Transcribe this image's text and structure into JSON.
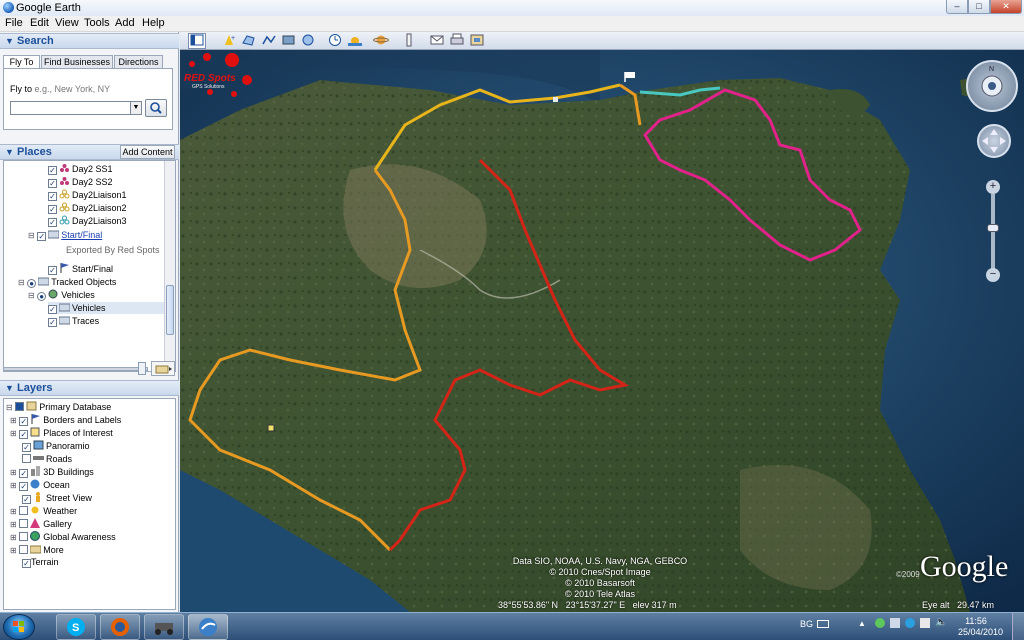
{
  "window": {
    "title": "Google Earth",
    "controls": {
      "minimize": "–",
      "maximize": "□",
      "close": "✕"
    }
  },
  "menu": [
    "File",
    "Edit",
    "View",
    "Tools",
    "Add",
    "Help"
  ],
  "search": {
    "header": "Search",
    "tabs": [
      "Fly To",
      "Find Businesses",
      "Directions"
    ],
    "fly_to_label": "Fly to",
    "fly_to_hint": "e.g., New York, NY",
    "input_value": ""
  },
  "places": {
    "header": "Places",
    "add_content_label": "Add Content",
    "items": [
      {
        "label": "Day2 SS1",
        "checked": true,
        "link": false
      },
      {
        "label": "Day2 SS2",
        "checked": true,
        "link": false
      },
      {
        "label": "Day2Liaison1",
        "checked": true,
        "link": false
      },
      {
        "label": "Day2Liaison2",
        "checked": true,
        "link": false
      },
      {
        "label": "Day2Liaison3",
        "checked": true,
        "link": false
      },
      {
        "label": "Start/Final",
        "checked": true,
        "link": true
      },
      {
        "label": "Exported By Red Spots",
        "checked": null,
        "link": false
      },
      {
        "label": "Start/Final",
        "checked": true,
        "link": false
      },
      {
        "label": "Tracked Objects",
        "checked": true,
        "link": false
      },
      {
        "label": "Vehicles",
        "checked": true,
        "link": false
      },
      {
        "label": "Vehicles",
        "checked": true,
        "link": false
      },
      {
        "label": "Traces",
        "checked": true,
        "link": false
      }
    ]
  },
  "layers": {
    "header": "Layers",
    "root": "Primary Database",
    "items": [
      {
        "label": "Borders and Labels",
        "checked": true
      },
      {
        "label": "Places of Interest",
        "checked": true
      },
      {
        "label": "Panoramio",
        "checked": true
      },
      {
        "label": "Roads",
        "checked": false
      },
      {
        "label": "3D Buildings",
        "checked": true
      },
      {
        "label": "Ocean",
        "checked": true
      },
      {
        "label": "Street View",
        "checked": true
      },
      {
        "label": "Weather",
        "checked": false
      },
      {
        "label": "Gallery",
        "checked": false
      },
      {
        "label": "Global Awareness",
        "checked": false
      },
      {
        "label": "More",
        "checked": false
      },
      {
        "label": "Terrain",
        "checked": true
      }
    ]
  },
  "toolbar_icons": [
    "sidebar-toggle-icon",
    "placemark-icon",
    "polygon-icon",
    "path-icon",
    "overlay-icon",
    "tour-icon",
    "historical-imagery-icon",
    "sunlight-icon",
    "planet-icon",
    "ruler-icon",
    "email-icon",
    "print-icon",
    "save-image-icon"
  ],
  "map": {
    "overlay_logo": "RED Spots",
    "overlay_logo_sub": "GPS Solutions",
    "attribution": [
      "Data SIO, NOAA, U.S. Navy, NGA, GEBCO",
      "© 2010 Cnes/Spot Image",
      "© 2010 Basarsoft",
      "© 2010 Tele Atlas"
    ],
    "coordinates": "38°55'53.86\" N",
    "longitude": "23°15'37.27\" E",
    "elevation": "elev  317 m",
    "eye_alt_label": "Eye alt",
    "eye_alt_value": "29.47 km",
    "google_logo": "Google",
    "copyright": "©2009"
  },
  "taskbar": {
    "tray_lang": "BG",
    "time": "11:56",
    "date": "25/04/2010"
  },
  "colors": {
    "route_yellow": "#e8b41c",
    "route_orange": "#e69a22",
    "route_red": "#d42418",
    "route_magenta": "#e0228a",
    "route_cyan": "#48c8c0",
    "panel_header_text": "#1c4f9a"
  }
}
